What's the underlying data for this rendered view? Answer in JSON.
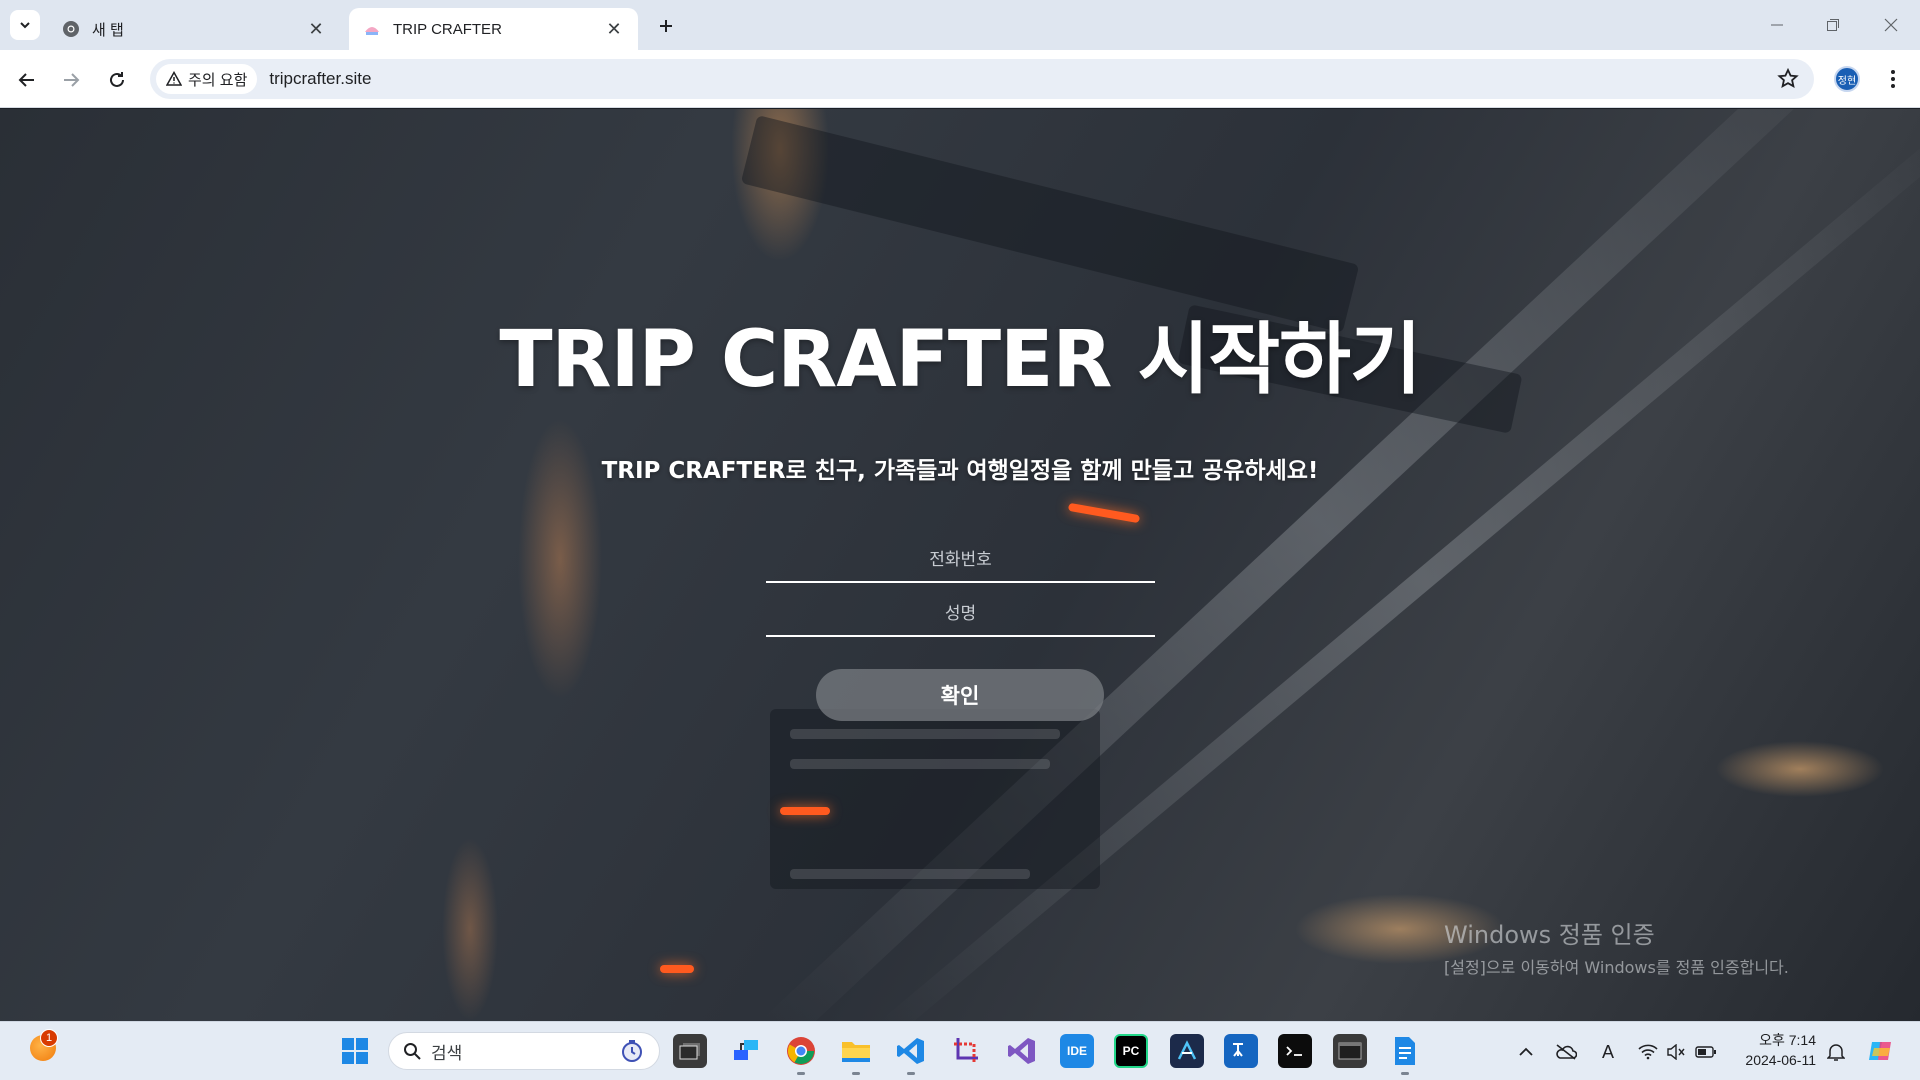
{
  "browser": {
    "tabs": [
      {
        "label": "새 탭",
        "active": false,
        "favicon": "chrome-icon"
      },
      {
        "label": "TRIP CRAFTER",
        "active": true,
        "favicon": "tripcrafter-favicon"
      }
    ],
    "security_chip": "주의 요함",
    "url": "tripcrafter.site",
    "profile_initials": "정현"
  },
  "page": {
    "title": "TRIP CRAFTER 시작하기",
    "subtitle": "TRIP CRAFTER로 친구, 가족들과 여행일정을 함께 만들고 공유하세요!",
    "form": {
      "phone_placeholder": "전화번호",
      "name_placeholder": "성명",
      "submit_label": "확인"
    },
    "activation_notice": {
      "title": "Windows 정품 인증",
      "body": "[설정]으로 이동하여 Windows를 정품 인증합니다."
    }
  },
  "taskbar": {
    "widget_badge_count": "1",
    "search_placeholder": "검색",
    "apps": [
      "windows-start-icon",
      "task-view-icon",
      "network-app-icon",
      "chrome-icon",
      "file-explorer-icon",
      "vscode-icon",
      "snipping-tool-icon",
      "visual-studio-icon",
      "intellij-icon",
      "pycharm-icon",
      "android-studio-icon",
      "translator-icon",
      "terminal-icon",
      "console-icon",
      "document-icon"
    ],
    "ide_label": "IDE",
    "pc_label": "PC",
    "clock": {
      "time": "오후 7:14",
      "date": "2024-06-11"
    },
    "tray_text_a": "A"
  },
  "colors": {
    "chrome_bg": "#dfe6f0",
    "omnibox_bg": "#e9eef6",
    "button_bg": "#787c82",
    "taskbar_bg": "#e4ebf4"
  }
}
